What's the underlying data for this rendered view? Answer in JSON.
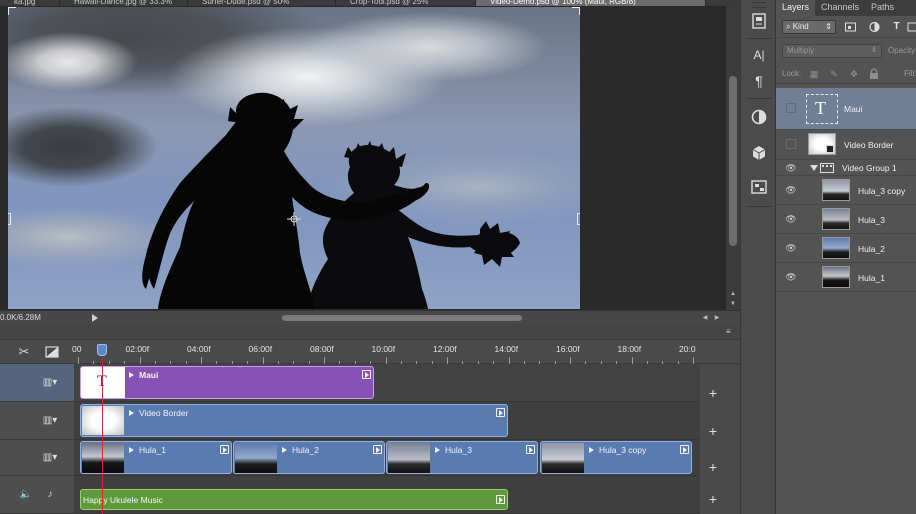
{
  "document_tabs": [
    {
      "label": "ka.jpg"
    },
    {
      "label": "Hawaii-Dance.jpg @ 33.3%"
    },
    {
      "label": "Surfer-Dude.psd @ 50%"
    },
    {
      "label": "Crop-Tool.psd @ 25%"
    },
    {
      "label": "Video-Demo.psd @ 100% (Maui, RGB/8)",
      "active": true
    }
  ],
  "status": {
    "doc_size": "0.0K/6.28M"
  },
  "panel_tabs": [
    {
      "label": "Layers",
      "active": true
    },
    {
      "label": "Channels"
    },
    {
      "label": "Paths"
    }
  ],
  "layers_panel": {
    "kind_filter": "Kind",
    "blend_mode": "Multiply",
    "opacity_label": "Opacity:",
    "lock_label": "Lock:",
    "fill_label": "Fill:",
    "layers": [
      {
        "name": "Maui",
        "type": "text",
        "selected": true,
        "visible": false
      },
      {
        "name": "Video Border",
        "type": "smart",
        "visible": false
      },
      {
        "name": "Video Group 1",
        "type": "group",
        "visible": true
      },
      {
        "name": "Hula_3 copy",
        "type": "video",
        "visible": true
      },
      {
        "name": "Hula_3",
        "type": "video",
        "visible": true
      },
      {
        "name": "Hula_2",
        "type": "video",
        "visible": true
      },
      {
        "name": "Hula_1",
        "type": "video",
        "visible": true
      }
    ]
  },
  "timeline": {
    "ruler_labels": [
      "00",
      "02:00f",
      "04:00f",
      "06:00f",
      "08:00f",
      "10:00f",
      "12:00f",
      "14:00f",
      "16:00f",
      "18:00f",
      "20:0"
    ],
    "tracks": [
      {
        "clips": [
          {
            "name": "Maui",
            "color": "#8751b6"
          }
        ]
      },
      {
        "clips": [
          {
            "name": "Video Border",
            "color": "#5a7bb0"
          }
        ]
      },
      {
        "clips": [
          {
            "name": "Hula_1",
            "color": "#5a7bb0"
          },
          {
            "name": "Hula_2",
            "color": "#5a7bb0"
          },
          {
            "name": "Hula_3",
            "color": "#5a7bb0"
          },
          {
            "name": "Hula_3 copy",
            "color": "#5a7bb0"
          }
        ]
      },
      {
        "clips": [
          {
            "name": "Happy Ukulele Music",
            "color": "#5e9a3a"
          }
        ]
      }
    ],
    "add_label": "+"
  },
  "icons": {
    "type_tool": "A|",
    "paragraph": "¶",
    "text_glyph": "T",
    "eye": "👁",
    "scissors": "✂",
    "note": "♪"
  }
}
